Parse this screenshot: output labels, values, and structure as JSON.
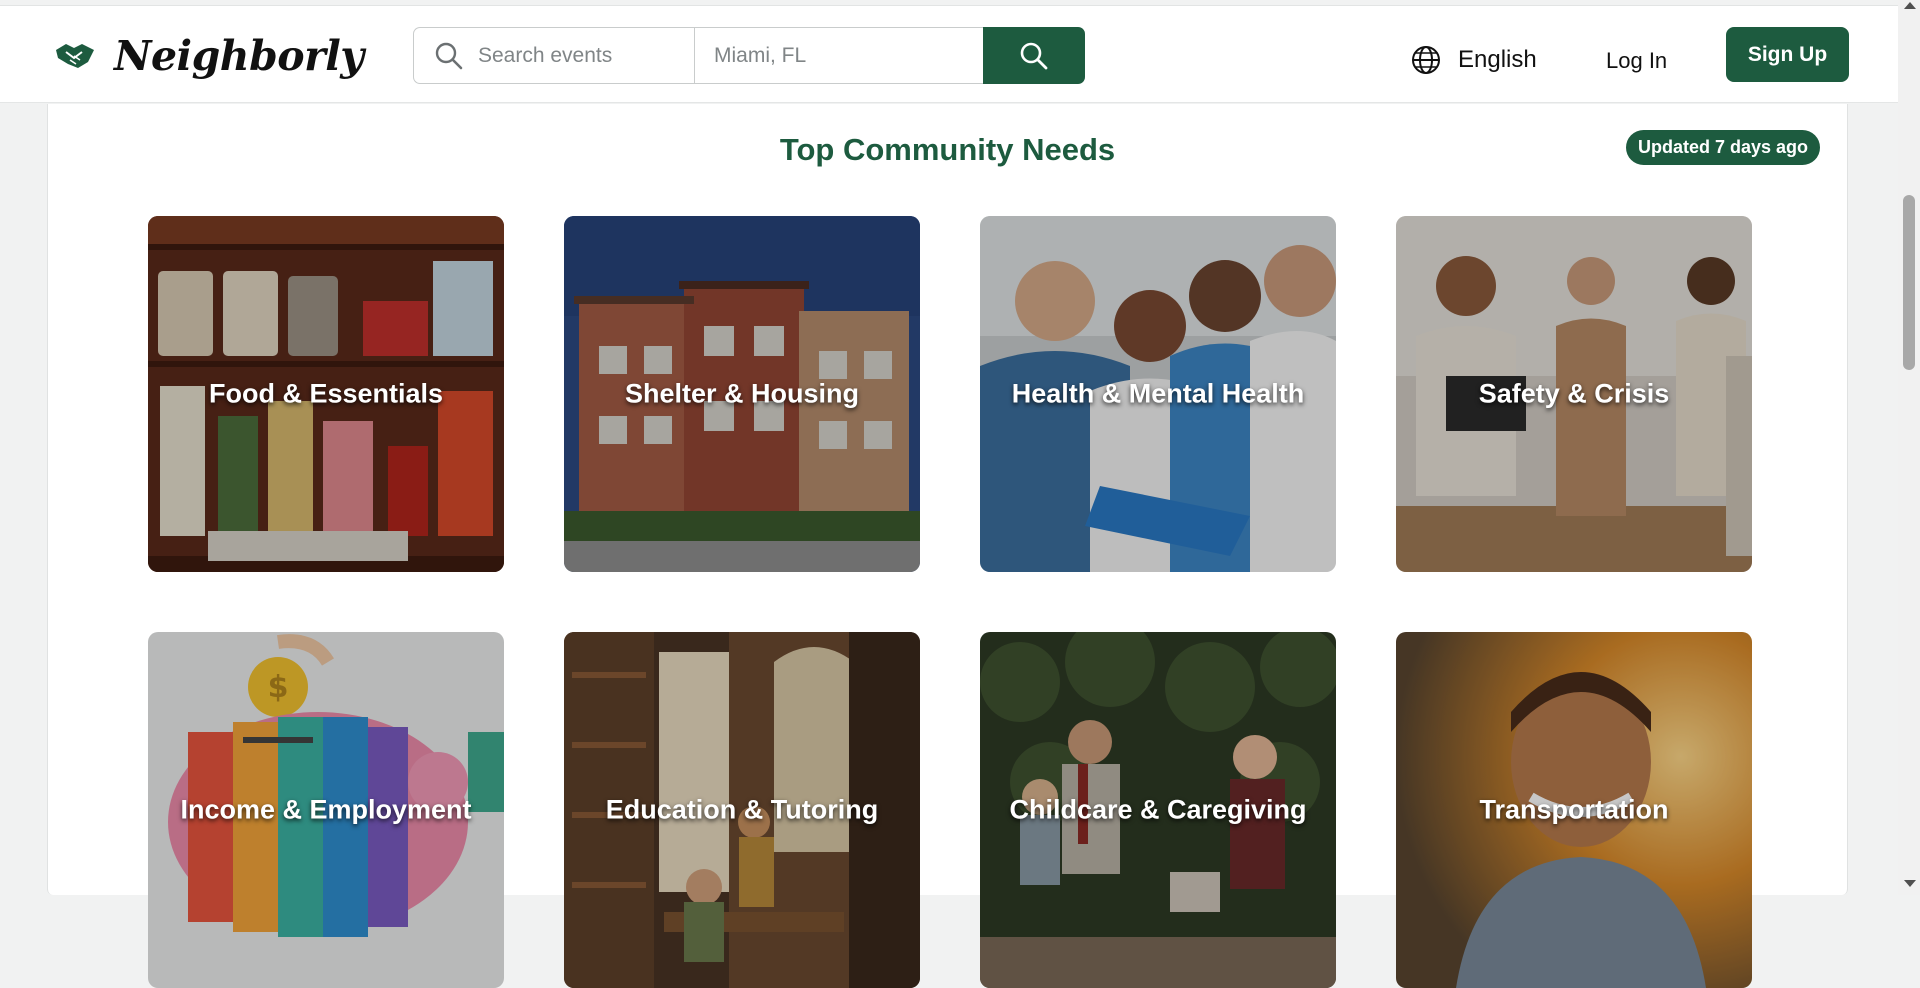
{
  "header": {
    "logo_text": "Neighborly",
    "search_placeholder": "Search events",
    "location_placeholder": "Miami, FL",
    "language": "English",
    "login_label": "Log In",
    "signup_label": "Sign Up"
  },
  "section": {
    "title": "Top Community Needs",
    "updated_badge": "Updated 7 days ago"
  },
  "categories": [
    {
      "label": "Food & Essentials",
      "icon": "pantry-image"
    },
    {
      "label": "Shelter & Housing",
      "icon": "apartment-image"
    },
    {
      "label": "Health & Mental Health",
      "icon": "doctors-image"
    },
    {
      "label": "Safety & Crisis",
      "icon": "support-group-image"
    },
    {
      "label": "Income & Employment",
      "icon": "piggy-bank-image"
    },
    {
      "label": "Education & Tutoring",
      "icon": "library-image"
    },
    {
      "label": "Childcare & Caregiving",
      "icon": "family-image"
    },
    {
      "label": "Transportation",
      "icon": "sunset-portrait-image"
    }
  ],
  "colors": {
    "brand": "#1d5b3f",
    "background": "#f1f2f2"
  }
}
